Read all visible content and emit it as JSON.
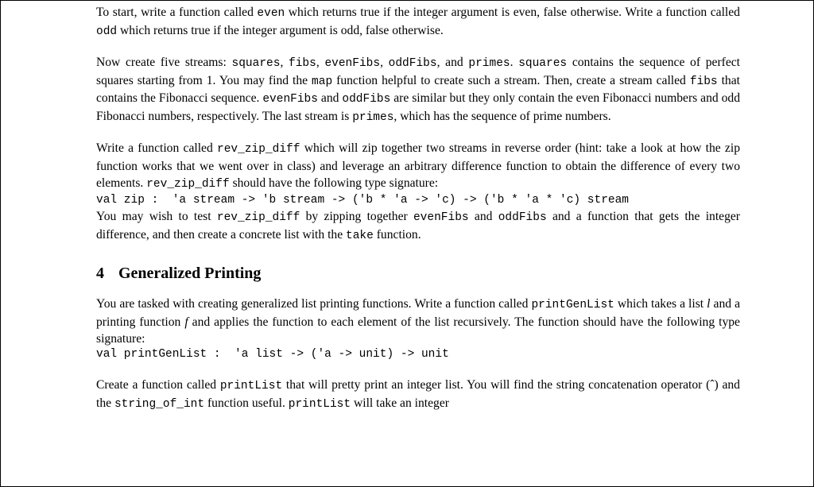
{
  "p1": {
    "t1": "To start, write a function called ",
    "c1": "even",
    "t2": " which returns true if the integer argument is even, false otherwise. Write a function called ",
    "c2": "odd",
    "t3": " which returns true if the integer argument is odd, false otherwise."
  },
  "p2": {
    "t1": "Now create five streams: ",
    "c1": "squares",
    "t2": ", ",
    "c2": "fibs",
    "t3": ", ",
    "c3": "evenFibs",
    "t4": ", ",
    "c4": "oddFibs",
    "t5": ", and ",
    "c5": "primes",
    "t6": ". ",
    "c6": "squares",
    "t7": " contains the sequence of perfect squares starting from 1. You may find the ",
    "c7": "map",
    "t8": " function helpful to create such a stream. Then, create a stream called ",
    "c8": "fibs",
    "t9": " that contains the Fibonacci sequence. ",
    "c9": "evenFibs",
    "t10": " and ",
    "c10": "oddFibs",
    "t11": " are similar but they only contain the even Fibonacci numbers and odd Fibonacci numbers, respectively. The last stream is ",
    "c11": "primes",
    "t12": ", which has the sequence of prime numbers."
  },
  "p3": {
    "t1": "Write a function called ",
    "c1a": "rev",
    "us1": "_",
    "c1b": "zip",
    "us2": "_",
    "c1c": "diff",
    "t2": " which will zip together two streams in reverse order (hint: take a look at how the zip function works that we went over in class) and leverage an arbitrary difference function to obtain the difference of every two elements. ",
    "c2a": "rev",
    "us3": "_",
    "c2b": "zip",
    "us4": "_",
    "c2c": "diff",
    "t3": " should have the following type signature:"
  },
  "sig1": "val zip :  'a stream -> 'b stream -> ('b * 'a -> 'c) -> ('b * 'a * 'c) stream",
  "p4": {
    "t1": "You may wish to test ",
    "c1a": "rev",
    "us1": "_",
    "c1b": "zip",
    "us2": "_",
    "c1c": "diff",
    "t2": " by zipping together ",
    "c2": "evenFibs",
    "t3": " and ",
    "c3": "oddFibs",
    "t4": " and a function that gets the integer difference, and then create a concrete list with the ",
    "c4": "take",
    "t5": " function."
  },
  "section": {
    "num": "4",
    "title": "Generalized Printing"
  },
  "p5": {
    "t1": "You are tasked with creating generalized list printing functions. Write a function called ",
    "c1": "printGenList",
    "t2": " which takes a list ",
    "i1": "l",
    "t3": " and a printing function ",
    "i2": "f",
    "t4": " and applies the function to each element of the list recursively. The function should have the following type signature:"
  },
  "sig2": "val printGenList :  'a list -> ('a -> unit) -> unit",
  "p6": {
    "t1": "Create a function called ",
    "c1": "printList",
    "t2": " that will pretty print an integer list. You will find the string concatenation operator (ˆ) and the ",
    "c2a": "string",
    "us1": "_",
    "c2b": "of",
    "us2": "_",
    "c2c": "int",
    "t3": " function useful. ",
    "c3": "printList",
    "t4": " will take an integer"
  }
}
